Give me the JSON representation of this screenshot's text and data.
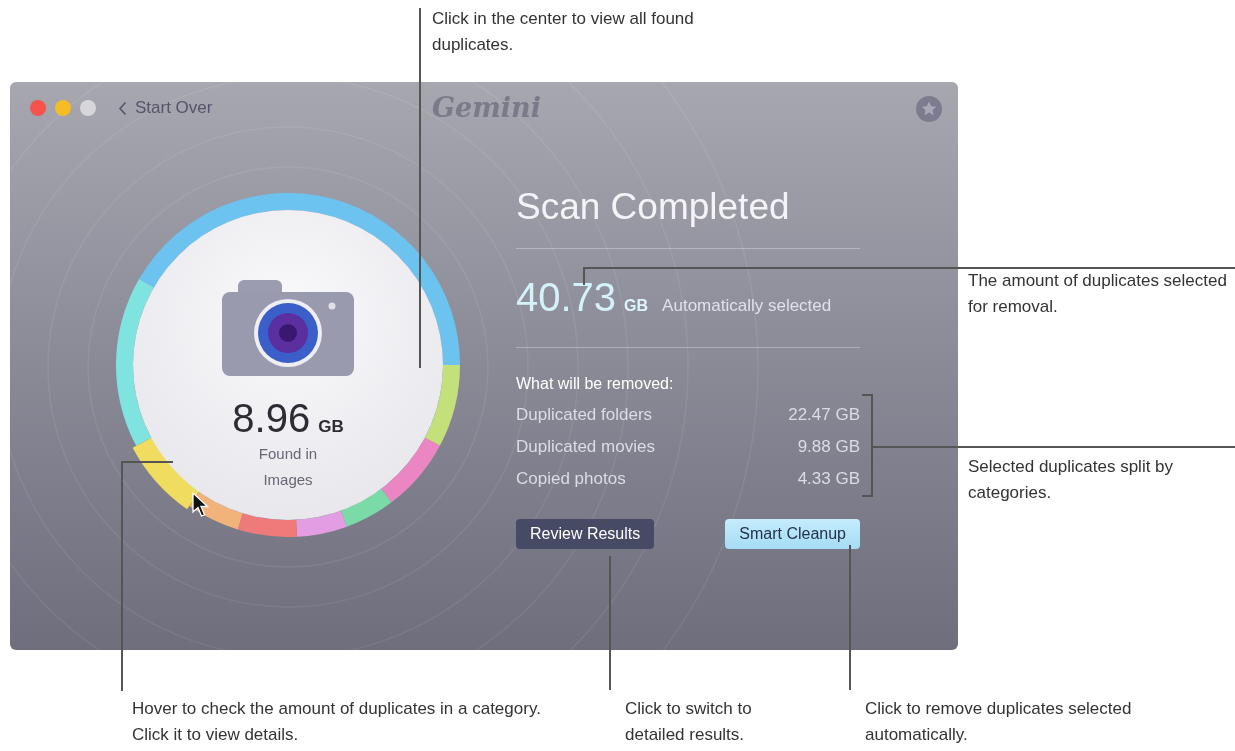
{
  "annotations": [
    {
      "text": "Click in the center to view all found duplicates."
    },
    {
      "text": "The amount of duplicates selected for removal."
    },
    {
      "text": "Selected duplicates split by categories."
    },
    {
      "text": "Hover to check the amount of duplicates in a category. Click it to view details."
    },
    {
      "text": "Click to switch to detailed results."
    },
    {
      "text": "Click to remove duplicates selected automatically."
    }
  ],
  "window": {
    "back_button": "Start Over",
    "logo": "Gemini",
    "ring": {
      "value": "8.96",
      "unit": "GB",
      "caption": "Found in Images"
    },
    "title": "Scan Completed",
    "total": {
      "value": "40.73",
      "unit": "GB",
      "label": "Automatically selected"
    },
    "removal": {
      "heading": "What will be removed:",
      "items": [
        {
          "name": "Duplicated folders",
          "size": "22.47 GB"
        },
        {
          "name": "Duplicated movies",
          "size": "9.88 GB"
        },
        {
          "name": "Copied photos",
          "size": "4.33 GB"
        }
      ]
    },
    "buttons": [
      {
        "label": "Review Results",
        "kind": "secondary"
      },
      {
        "label": "Smart Cleanup",
        "kind": "primary"
      }
    ]
  }
}
